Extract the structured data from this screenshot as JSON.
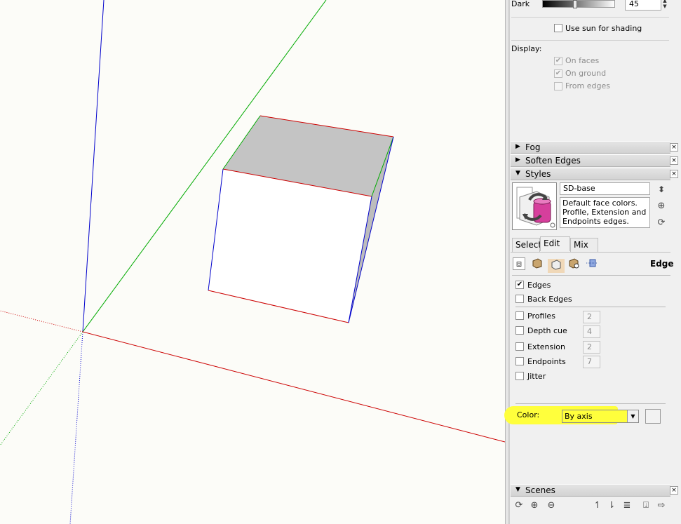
{
  "shadow": {
    "dark_label": "Dark",
    "dark_value": "45",
    "dark_level": 0.45,
    "use_sun_label": "Use sun for shading",
    "use_sun_checked": false,
    "display_label": "Display:",
    "on_faces_label": "On faces",
    "on_ground_label": "On ground",
    "from_edges_label": "From edges"
  },
  "panels": {
    "fog": "Fog",
    "soften_edges": "Soften Edges",
    "styles": "Styles",
    "scenes": "Scenes"
  },
  "style": {
    "name": "SD-base",
    "description": "Default face colors. Profile, Extension and Endpoints edges. Light"
  },
  "tabs": {
    "select": "Select",
    "edit": "Edit",
    "mix": "Mix",
    "section_label": "Edge"
  },
  "edges": {
    "edges_label": "Edges",
    "edges_checked": true,
    "back_edges_label": "Back Edges",
    "profiles_label": "Profiles",
    "profiles_value": "2",
    "depth_cue_label": "Depth cue",
    "depth_cue_value": "4",
    "extension_label": "Extension",
    "extension_value": "2",
    "endpoints_label": "Endpoints",
    "endpoints_value": "7",
    "jitter_label": "Jitter",
    "color_label": "Color:",
    "color_value": "By axis"
  },
  "colors": {
    "highlight": "#ffff3c",
    "axis_red": "#cc0000",
    "axis_green": "#00aa00",
    "axis_blue": "#0000cc",
    "face_top": "#c4c4c4",
    "face_right": "#bdbdbd",
    "face_front": "#ffffff",
    "style_thumbnail": "#d63f9c"
  },
  "icons": {
    "triangle_collapsed": "▶",
    "triangle_expanded": "▼",
    "close": "×",
    "check": "✔"
  }
}
